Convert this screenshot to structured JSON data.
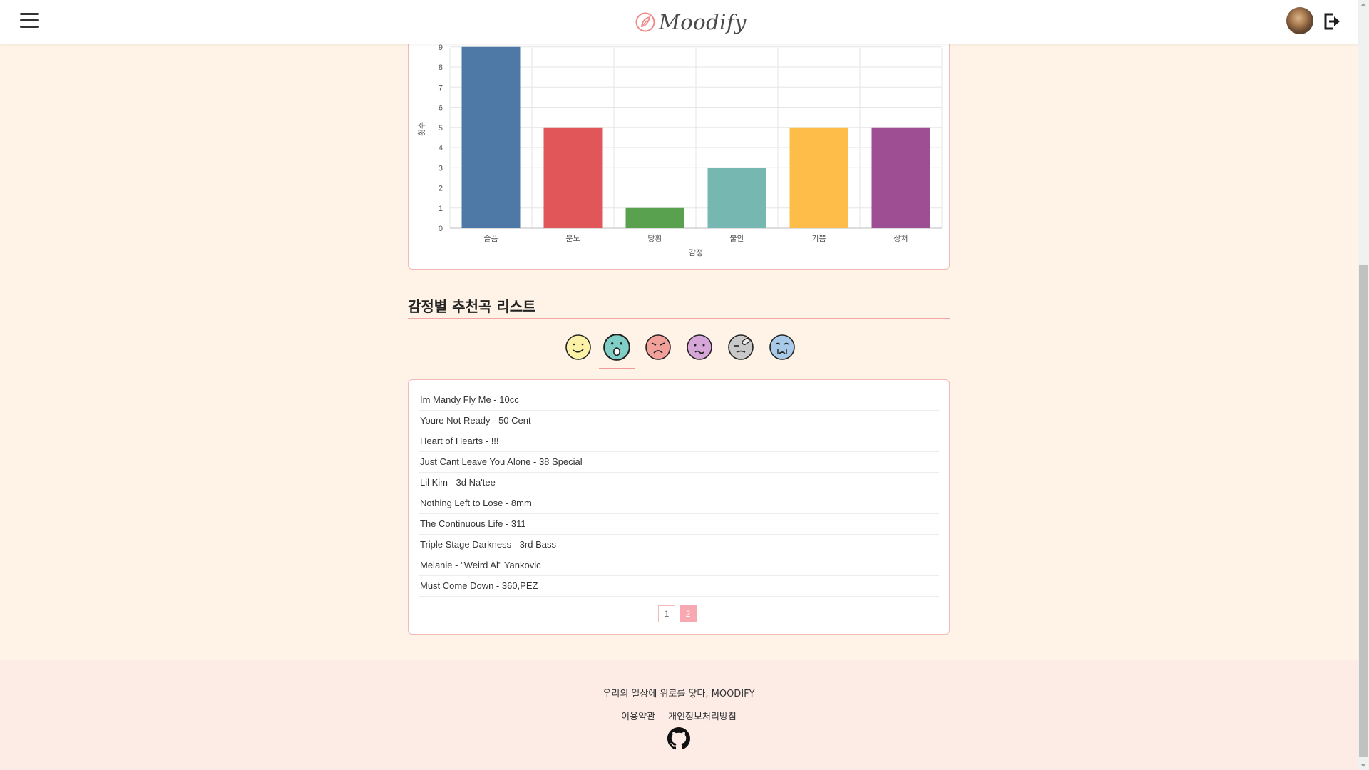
{
  "header": {
    "brand": "Moodify",
    "menu_icon": "hamburger-menu-icon",
    "avatar_icon": "user-avatar",
    "logout_icon": "logout-icon"
  },
  "chart_data": {
    "type": "bar",
    "categories": [
      "슬픔",
      "분노",
      "당황",
      "불안",
      "기쁨",
      "상처"
    ],
    "values": [
      9,
      5,
      1,
      3,
      5,
      5
    ],
    "colors": [
      "#4e79a7",
      "#e15759",
      "#59a14f",
      "#76b7b2",
      "#fdbd48",
      "#9e4f93"
    ],
    "xlabel": "감정",
    "ylabel": "횟수",
    "ylim": [
      0,
      9
    ],
    "yticks": [
      0,
      1,
      2,
      3,
      4,
      5,
      6,
      7,
      8,
      9
    ],
    "grid": true
  },
  "recommendations": {
    "title": "감정별 추천곡 리스트",
    "emotion_tabs": [
      {
        "name": "happy-face-icon",
        "color": "#fbf2a8",
        "active": false
      },
      {
        "name": "surprised-face-icon",
        "color": "#7fcfc6",
        "active": true
      },
      {
        "name": "angry-face-icon",
        "color": "#f2a09a",
        "active": false
      },
      {
        "name": "anxious-face-icon",
        "color": "#d6a6d8",
        "active": false
      },
      {
        "name": "hurt-face-icon",
        "color": "#c9c9c9",
        "active": false
      },
      {
        "name": "sad-face-icon",
        "color": "#a9c9e8",
        "active": false
      }
    ],
    "songs": [
      "Im Mandy Fly Me - 10cc",
      "Youre Not Ready - 50 Cent",
      "Heart of Hearts - !!!",
      "Just Cant Leave You Alone - 38 Special",
      "Lil Kim - 3d Na'tee",
      "Nothing Left to Lose - 8mm",
      "The Continuous Life - 311",
      "Triple Stage Darkness - 3rd Bass",
      "Melanie - \"Weird Al\" Yankovic",
      "Must Come Down - 360,PEZ"
    ],
    "pages": [
      "1",
      "2"
    ],
    "current_page": "2"
  },
  "footer": {
    "tagline": "우리의 일상에 위로를 닿다, MOODIFY",
    "terms": "이용약관",
    "privacy": "개인정보처리방침",
    "github_icon": "github-icon"
  }
}
